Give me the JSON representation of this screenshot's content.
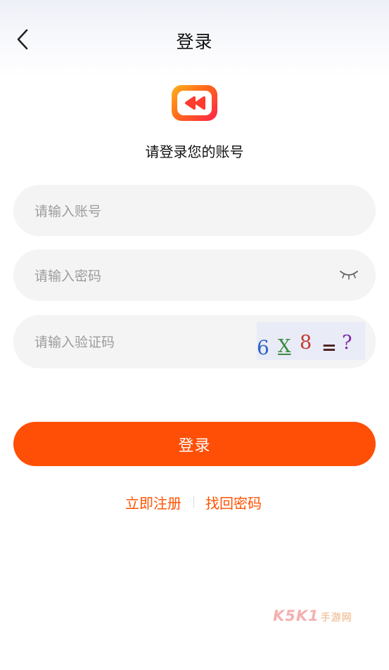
{
  "header": {
    "title": "登录"
  },
  "icons": {
    "back": "chevron-left-icon",
    "logo": "app-logo-icon",
    "eye": "eye-closed-icon"
  },
  "subtitle": "请登录您的账号",
  "form": {
    "account_placeholder": "请输入账号",
    "password_placeholder": "请输入密码",
    "captcha_placeholder": "请输入验证码",
    "captcha_chars": [
      "6",
      "X",
      "8",
      "=",
      "?"
    ]
  },
  "actions": {
    "login_label": "登录",
    "register_label": "立即注册",
    "forgot_label": "找回密码"
  },
  "watermark": {
    "main": "K5K1",
    "sub": "手游网"
  },
  "colors": {
    "accent": "#ff4f06",
    "link": "#ff5200",
    "field_bg": "#f4f4f4"
  }
}
